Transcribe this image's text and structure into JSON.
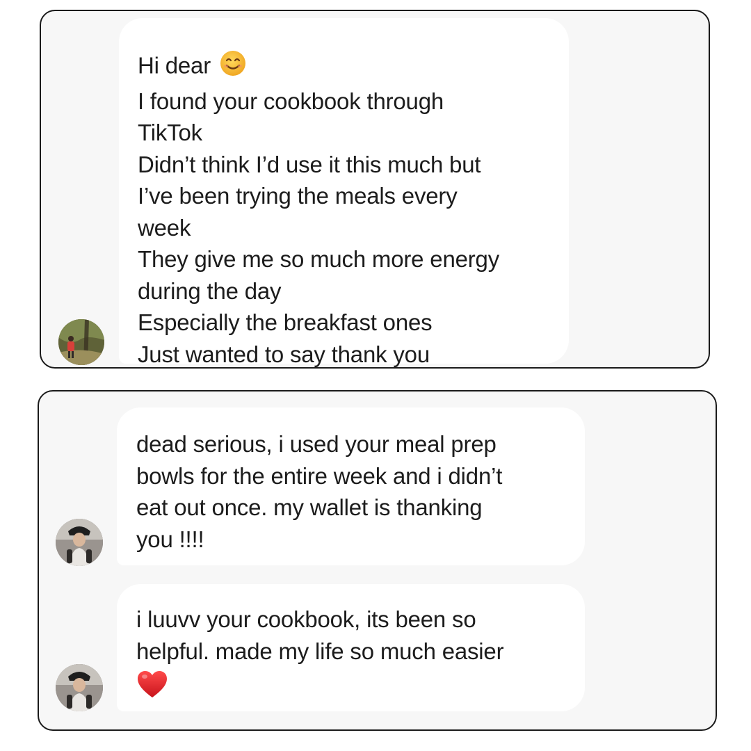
{
  "cards": [
    {
      "messages": [
        {
          "lines": [
            "Hi dear",
            "I found your cookbook through",
            "TikTok",
            "Didn’t think I’d use it this much but",
            "I’ve been trying the meals every",
            "week",
            "They give me so much more energy",
            "during the day",
            "Especially the breakfast ones",
            "Just wanted to say thank you"
          ],
          "emoji": "smiling-face-emoji"
        }
      ],
      "avatar": "profile-photo-person-in-park"
    },
    {
      "messages": [
        {
          "lines": [
            "dead serious, i used your meal prep",
            "bowls for the entire week and i didn’t",
            "eat out once. my wallet is thanking",
            "you !!!!"
          ]
        },
        {
          "lines": [
            "i luuvv your cookbook, its been so",
            "helpful. made my life so much easier"
          ],
          "emoji": "red-heart-emoji"
        }
      ],
      "avatar": "profile-photo-person-bucket-hat"
    }
  ],
  "colors": {
    "card_background": "#f7f7f7",
    "card_border": "#1a1a1a",
    "bubble_background": "#ffffff",
    "text": "#1c1c1c",
    "heart": "#e0262b",
    "smile": "#f6b933"
  }
}
